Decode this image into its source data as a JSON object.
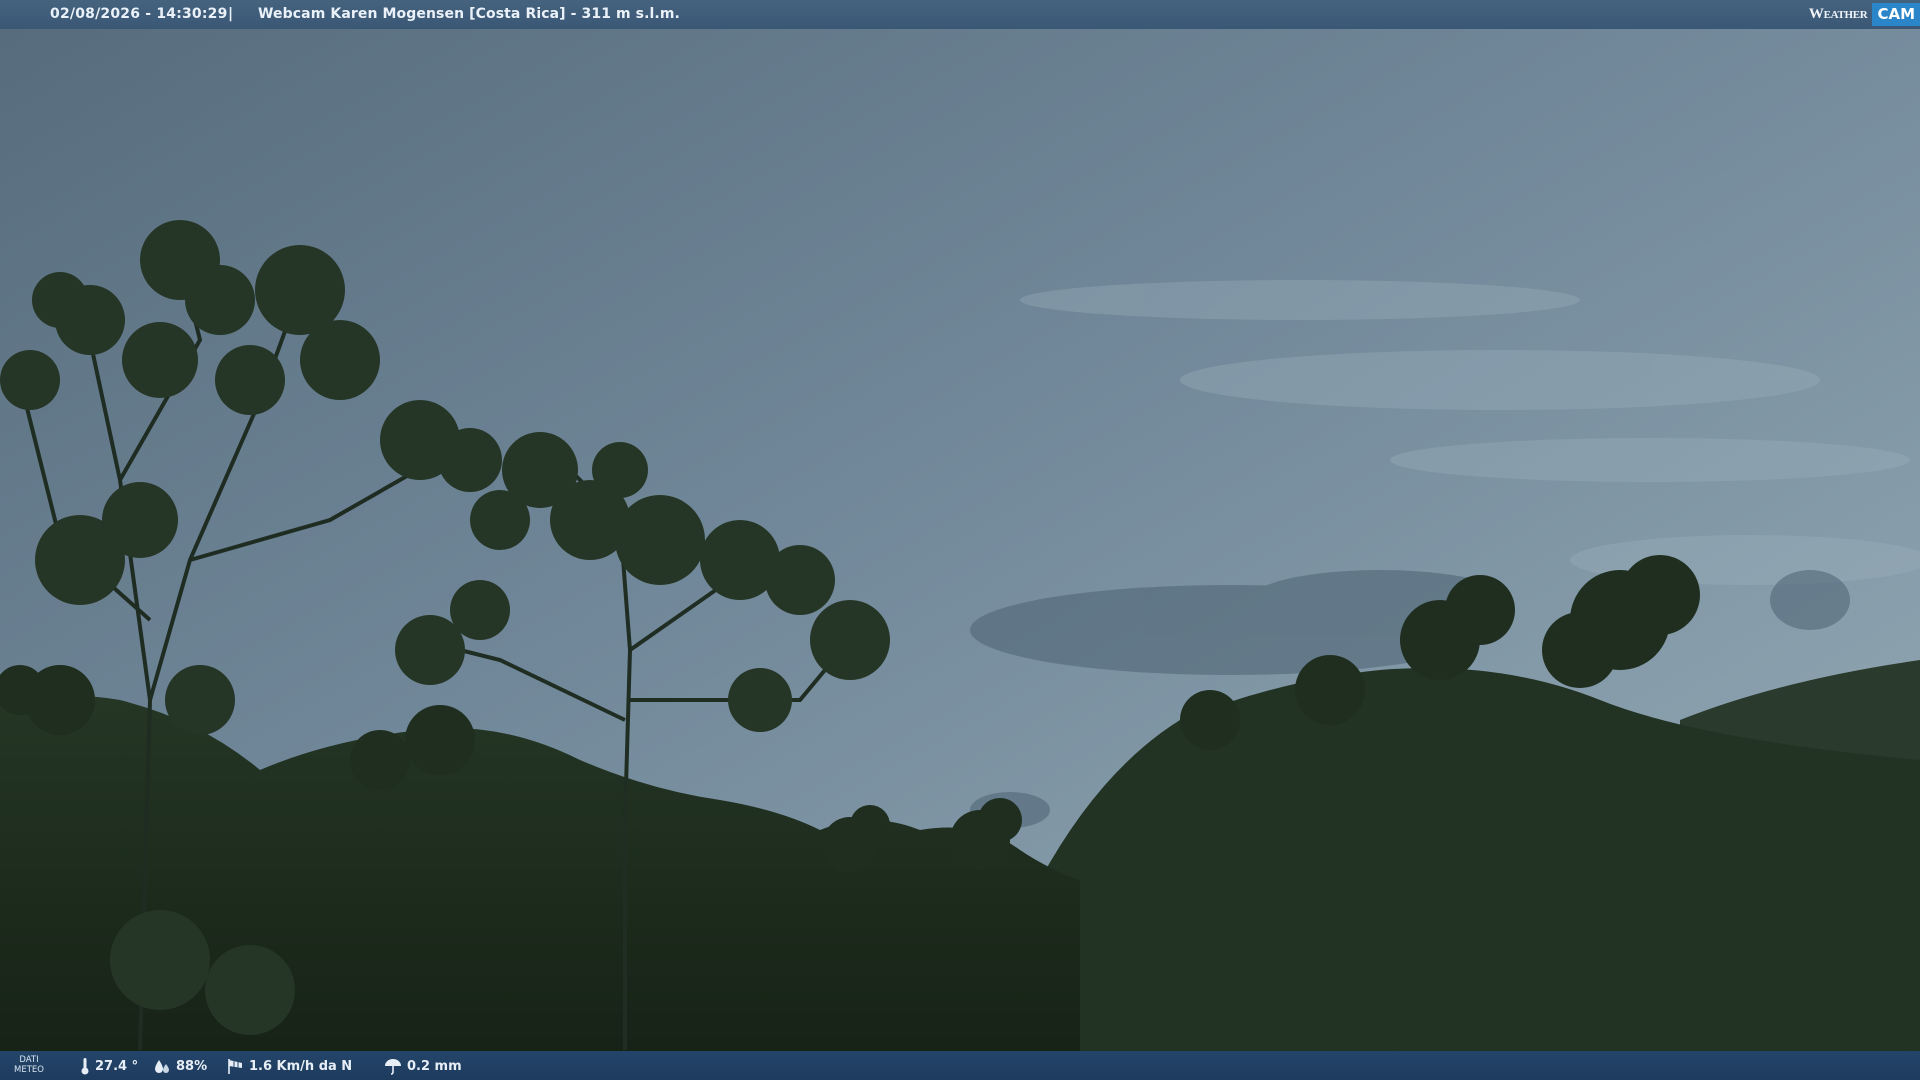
{
  "header": {
    "datetime": "02/08/2026 - 14:30:29",
    "separator": "|",
    "title": "Webcam Karen Mogensen [Costa Rica]  - 311 m s.l.m.",
    "logo": {
      "left_text": "Weather",
      "right_text": "CAM"
    }
  },
  "footer": {
    "section_label_line1": "DATI",
    "section_label_line2": "METEO",
    "temperature": "27.4 °",
    "humidity": "88%",
    "wind": "1.6 Km/h da N",
    "rain": "0.2 mm"
  },
  "icons": {
    "temperature": "thermometer-icon",
    "humidity": "water-drops-icon",
    "wind": "wind-sock-icon",
    "rain": "umbrella-icon"
  },
  "colors": {
    "topbar": "#3f5d7a",
    "bottombar": "#21416a",
    "logo_accent": "#2a86c8",
    "sky": "#6f8594",
    "foliage": "#1c2a1c"
  }
}
